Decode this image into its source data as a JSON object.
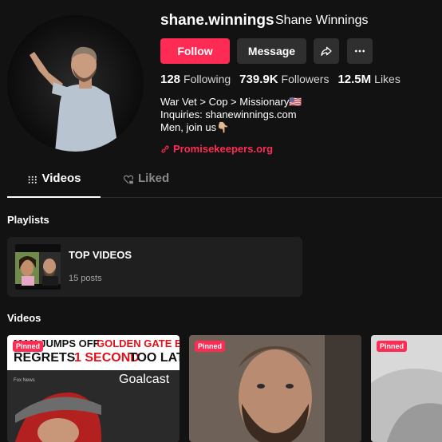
{
  "profile": {
    "username": "shane.winnings",
    "display_name": "Shane Winnings",
    "follow_label": "Follow",
    "message_label": "Message",
    "stats": {
      "following_count": "128",
      "following_label": "Following",
      "followers_count": "739.9K",
      "followers_label": "Followers",
      "likes_count": "12.5M",
      "likes_label": "Likes"
    },
    "bio": {
      "line1": "War Vet > Cop > Missionary🇺🇸",
      "line2": "Inquiries: shanewinnings.com",
      "line3": "Men, join us👇🏼"
    },
    "link": "Promisekeepers.org"
  },
  "tabs": [
    {
      "label": "Videos",
      "active": true
    },
    {
      "label": "Liked",
      "active": false
    }
  ],
  "playlists": {
    "title": "Playlists",
    "items": [
      {
        "title": "TOP VIDEOS",
        "count": "15 posts"
      }
    ]
  },
  "videos": {
    "title": "Videos",
    "items": [
      {
        "pinned_label": "Pinned",
        "headline_line1_a": "MAN JUMPS OFF ",
        "headline_line1_b": "GOLDEN GATE BRIDGE",
        "headline_line2_a": "REGRETS ",
        "headline_line2_b": "1 SECOND",
        "headline_line2_c": " TOO LATE",
        "brand": "Goalcast",
        "source": "Fox News"
      },
      {
        "pinned_label": "Pinned"
      },
      {
        "pinned_label": "Pinned"
      }
    ]
  },
  "colors": {
    "accent": "#fe2c55",
    "background": "#121212",
    "button_secondary": "#2f2f2f",
    "card": "#1f1f1f"
  },
  "icons": {
    "share": "share-arrow-icon",
    "more": "more-dots-icon",
    "link": "link-icon",
    "videos_tab": "grid-icon",
    "liked_tab": "heart-lock-icon"
  }
}
